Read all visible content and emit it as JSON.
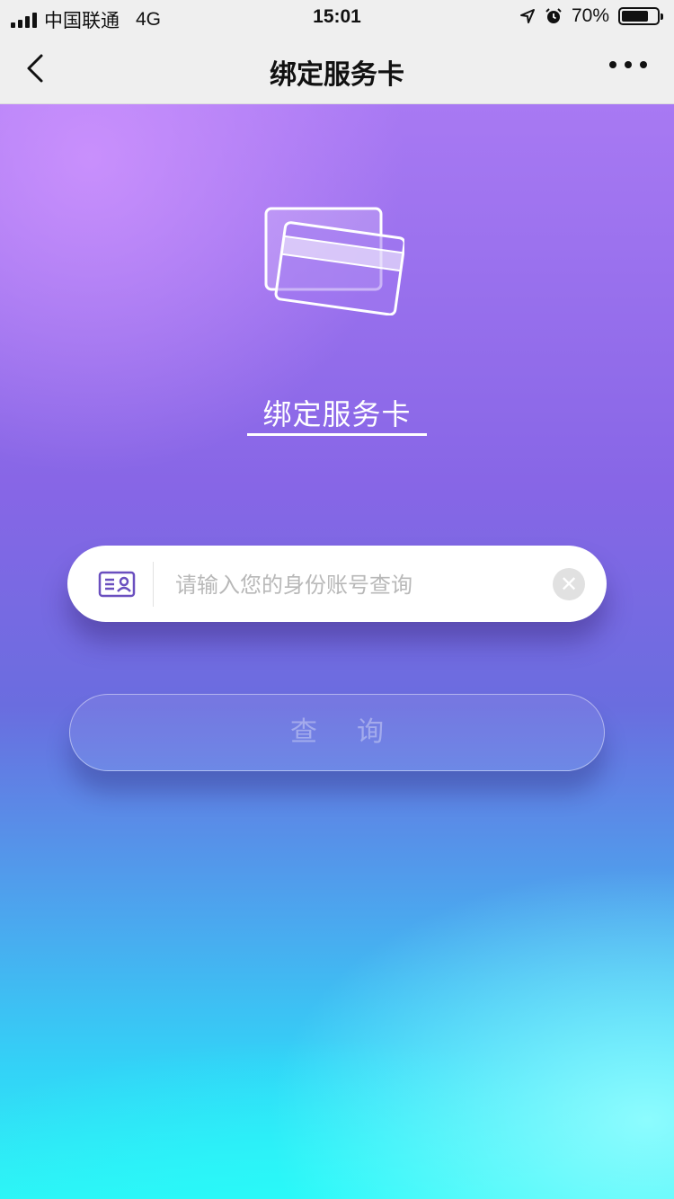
{
  "status_bar": {
    "carrier": "中国联通",
    "network": "4G",
    "time": "15:01",
    "battery": "70%"
  },
  "nav": {
    "title": "绑定服务卡"
  },
  "hero": {
    "title": "绑定服务卡"
  },
  "search": {
    "placeholder": "请输入您的身份账号查询",
    "value": ""
  },
  "query_button": {
    "label": "查询"
  },
  "colors": {
    "gradient_top": "#a879f3",
    "gradient_bottom": "#2ef4f5",
    "icon_accent": "#6a4fbf"
  }
}
